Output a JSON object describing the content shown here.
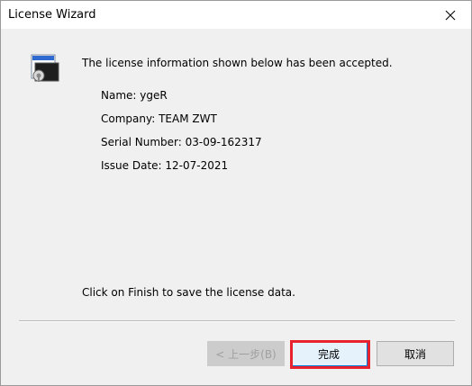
{
  "window": {
    "title": "License Wizard",
    "close_label": "✕"
  },
  "content": {
    "headline": "The license information shown below has been accepted.",
    "info": {
      "name": "Name: ygeR",
      "company": "Company: TEAM ZWT",
      "serial": "Serial Number: 03-09-162317",
      "issue_date": "Issue Date: 12-07-2021"
    },
    "footer_message": "Click on Finish to save the license data."
  },
  "buttons": {
    "back_label": "< 上一步(B)",
    "finish_label": "完成",
    "cancel_label": "取消"
  },
  "colors": {
    "highlight": "#e8232d",
    "primary_border": "#0078d7"
  }
}
